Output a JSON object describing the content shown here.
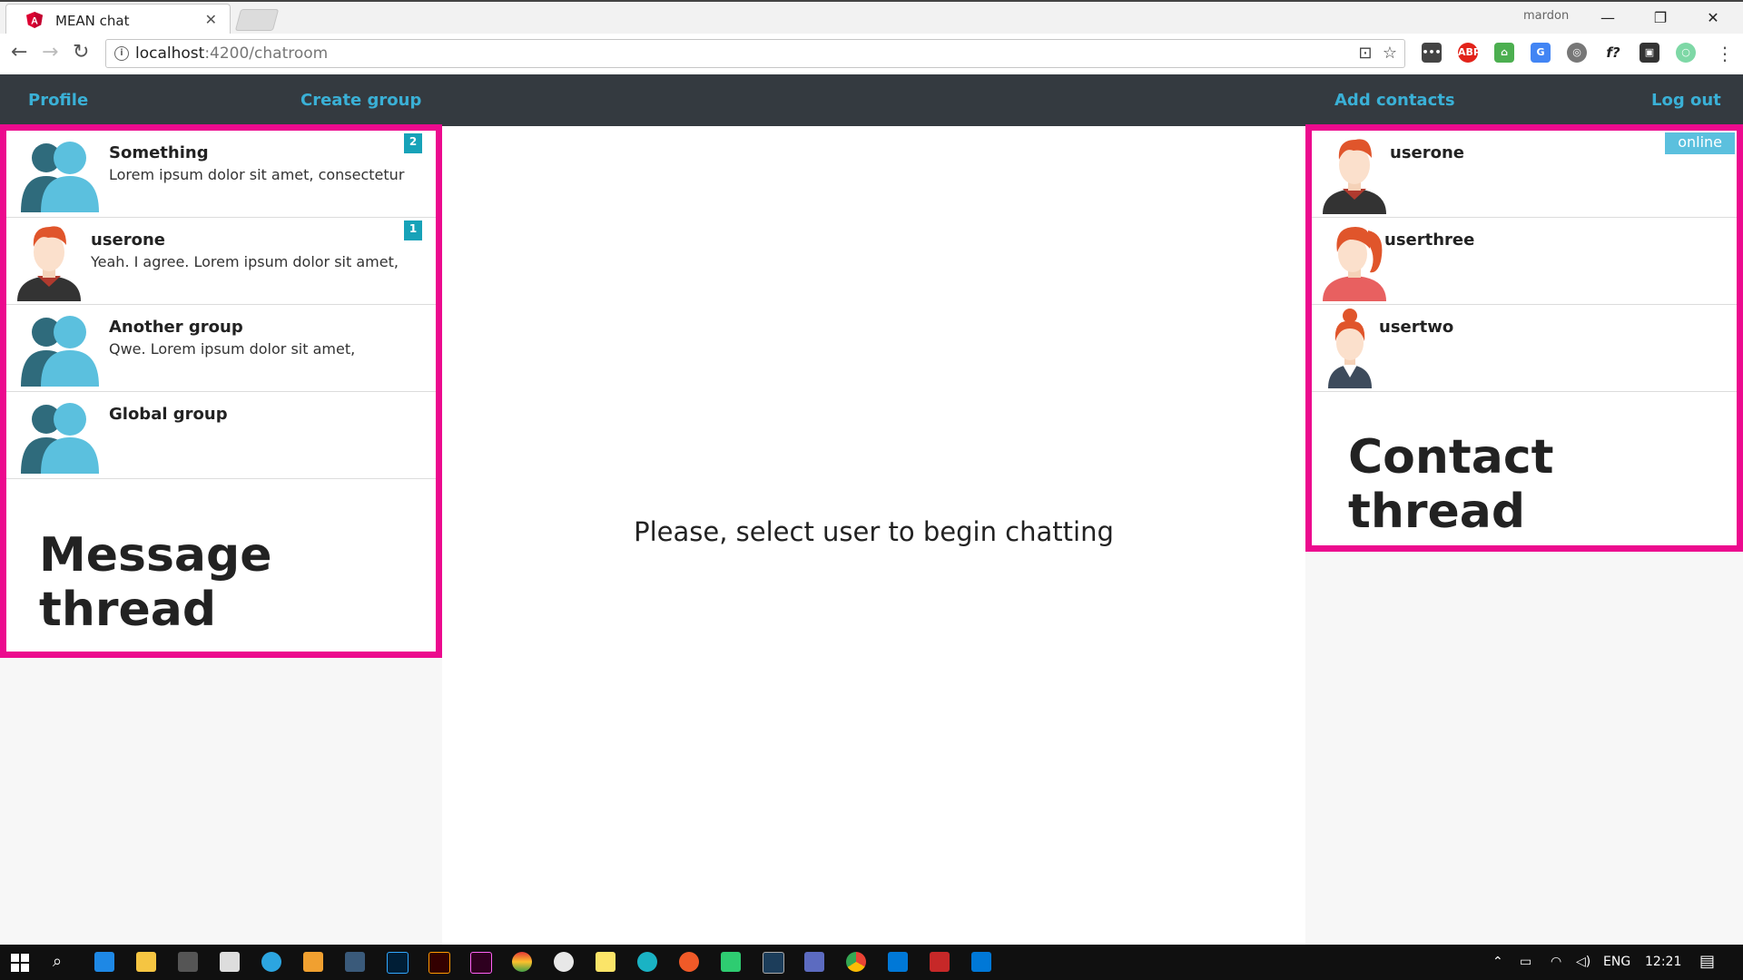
{
  "browser": {
    "tab_title": "MEAN chat",
    "profile_name": "mardon",
    "url_host": "localhost",
    "url_path": ":4200/chatroom"
  },
  "nav": {
    "profile": "Profile",
    "create_group": "Create group",
    "add_contacts": "Add contacts",
    "logout": "Log out"
  },
  "messages": [
    {
      "name": "Something",
      "preview": "Lorem ipsum dolor sit amet, consectetur",
      "badge": "2",
      "avatar": "group-icon"
    },
    {
      "name": "userone",
      "preview": "Yeah. I agree. Lorem ipsum dolor sit amet,",
      "badge": "1",
      "avatar": "user-male-icon"
    },
    {
      "name": "Another group",
      "preview": "Qwe. Lorem ipsum dolor sit amet,",
      "badge": "",
      "avatar": "group-icon"
    },
    {
      "name": "Global group",
      "preview": "",
      "badge": "",
      "avatar": "group-icon"
    }
  ],
  "message_thread_label": "Message thread",
  "contacts": [
    {
      "name": "userone",
      "status": "online",
      "avatar": "user-male-icon"
    },
    {
      "name": "userthree",
      "status": "",
      "avatar": "user-female-ponytail-icon"
    },
    {
      "name": "usertwo",
      "status": "",
      "avatar": "user-female-bun-icon"
    }
  ],
  "contact_thread_label": "Contact thread",
  "center_message": "Please, select user to begin chatting",
  "taskbar": {
    "language": "ENG",
    "time": "12:21"
  },
  "colors": {
    "accent": "#3ab0d6",
    "highlight_border": "#ec0a8e",
    "navbar": "#343a40",
    "badge": "#17a2b8",
    "online": "#5bc0de"
  }
}
